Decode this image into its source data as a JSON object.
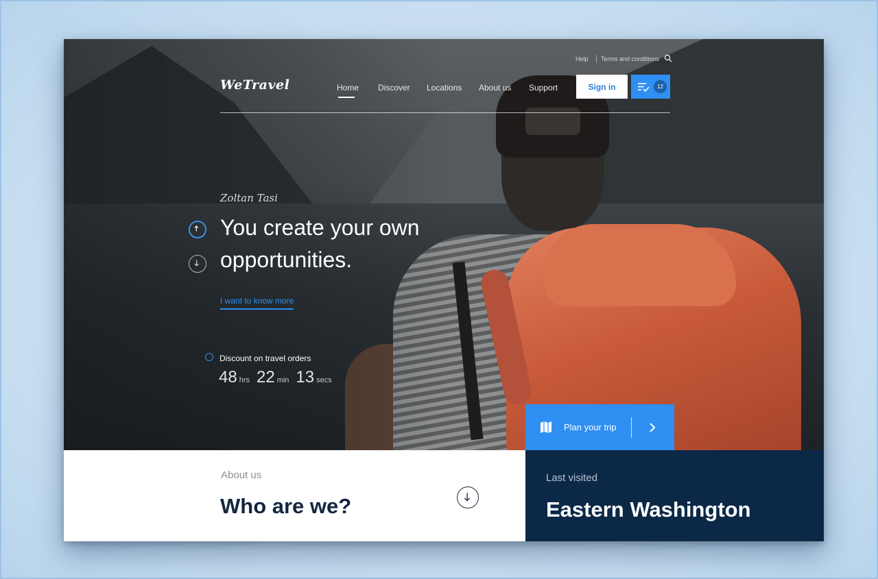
{
  "header": {
    "help_label": "Help",
    "terms_label": "Terms and conditions",
    "logo_text": "WeTravel",
    "nav": [
      {
        "label": "Home"
      },
      {
        "label": "Discover"
      },
      {
        "label": "Locations"
      },
      {
        "label": "About us"
      },
      {
        "label": "Support"
      }
    ],
    "active_nav": "Home",
    "signin_label": "Sign in",
    "list_badge": "12"
  },
  "hero": {
    "author": "Zoltan Tasi",
    "headline": "You create your own opportunities.",
    "cta_link": "I want to know more",
    "discount_label": "Discount on travel orders",
    "timer": {
      "hours": "48",
      "hours_unit": "hrs",
      "minutes": "22",
      "minutes_unit": "min",
      "seconds": "13",
      "seconds_unit": "secs"
    },
    "plan_label": "Plan your trip"
  },
  "about": {
    "eyebrow": "About us",
    "title": "Who are we?"
  },
  "last_visited": {
    "eyebrow": "Last visited",
    "title": "Eastern Washington"
  },
  "colors": {
    "accent": "#2f8ff2",
    "navy": "#0c2847",
    "title_dark": "#14263f"
  },
  "icons": [
    "search-icon",
    "list-check-icon",
    "arrow-up-icon",
    "arrow-down-icon",
    "compass-icon",
    "map-icon",
    "chevron-right-icon"
  ]
}
